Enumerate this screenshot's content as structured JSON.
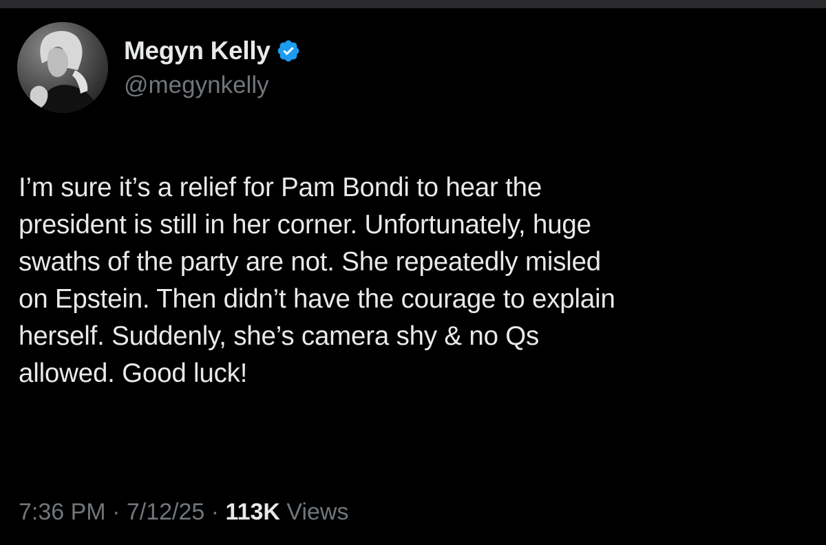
{
  "author": {
    "display_name": "Megyn Kelly",
    "handle": "@megynkelly",
    "verified": true,
    "verified_icon": "verified-badge-icon",
    "verified_color": "#1d9bf0"
  },
  "tweet": {
    "lines": [
      "I’m sure it’s a relief for Pam Bondi to hear the",
      "president is still in her corner. Unfortunately, huge",
      "swaths of the party are not. She repeatedly misled",
      "on Epstein. Then didn’t have the courage to explain",
      "herself. Suddenly, she’s camera shy & no Qs",
      "allowed. Good luck!"
    ]
  },
  "meta": {
    "time": "7:36 PM",
    "separator": "·",
    "date": "7/12/25",
    "views_count": "113K",
    "views_label": "Views"
  },
  "colors": {
    "background": "#000000",
    "primary_text": "#e7e9ea",
    "secondary_text": "#71767b"
  }
}
